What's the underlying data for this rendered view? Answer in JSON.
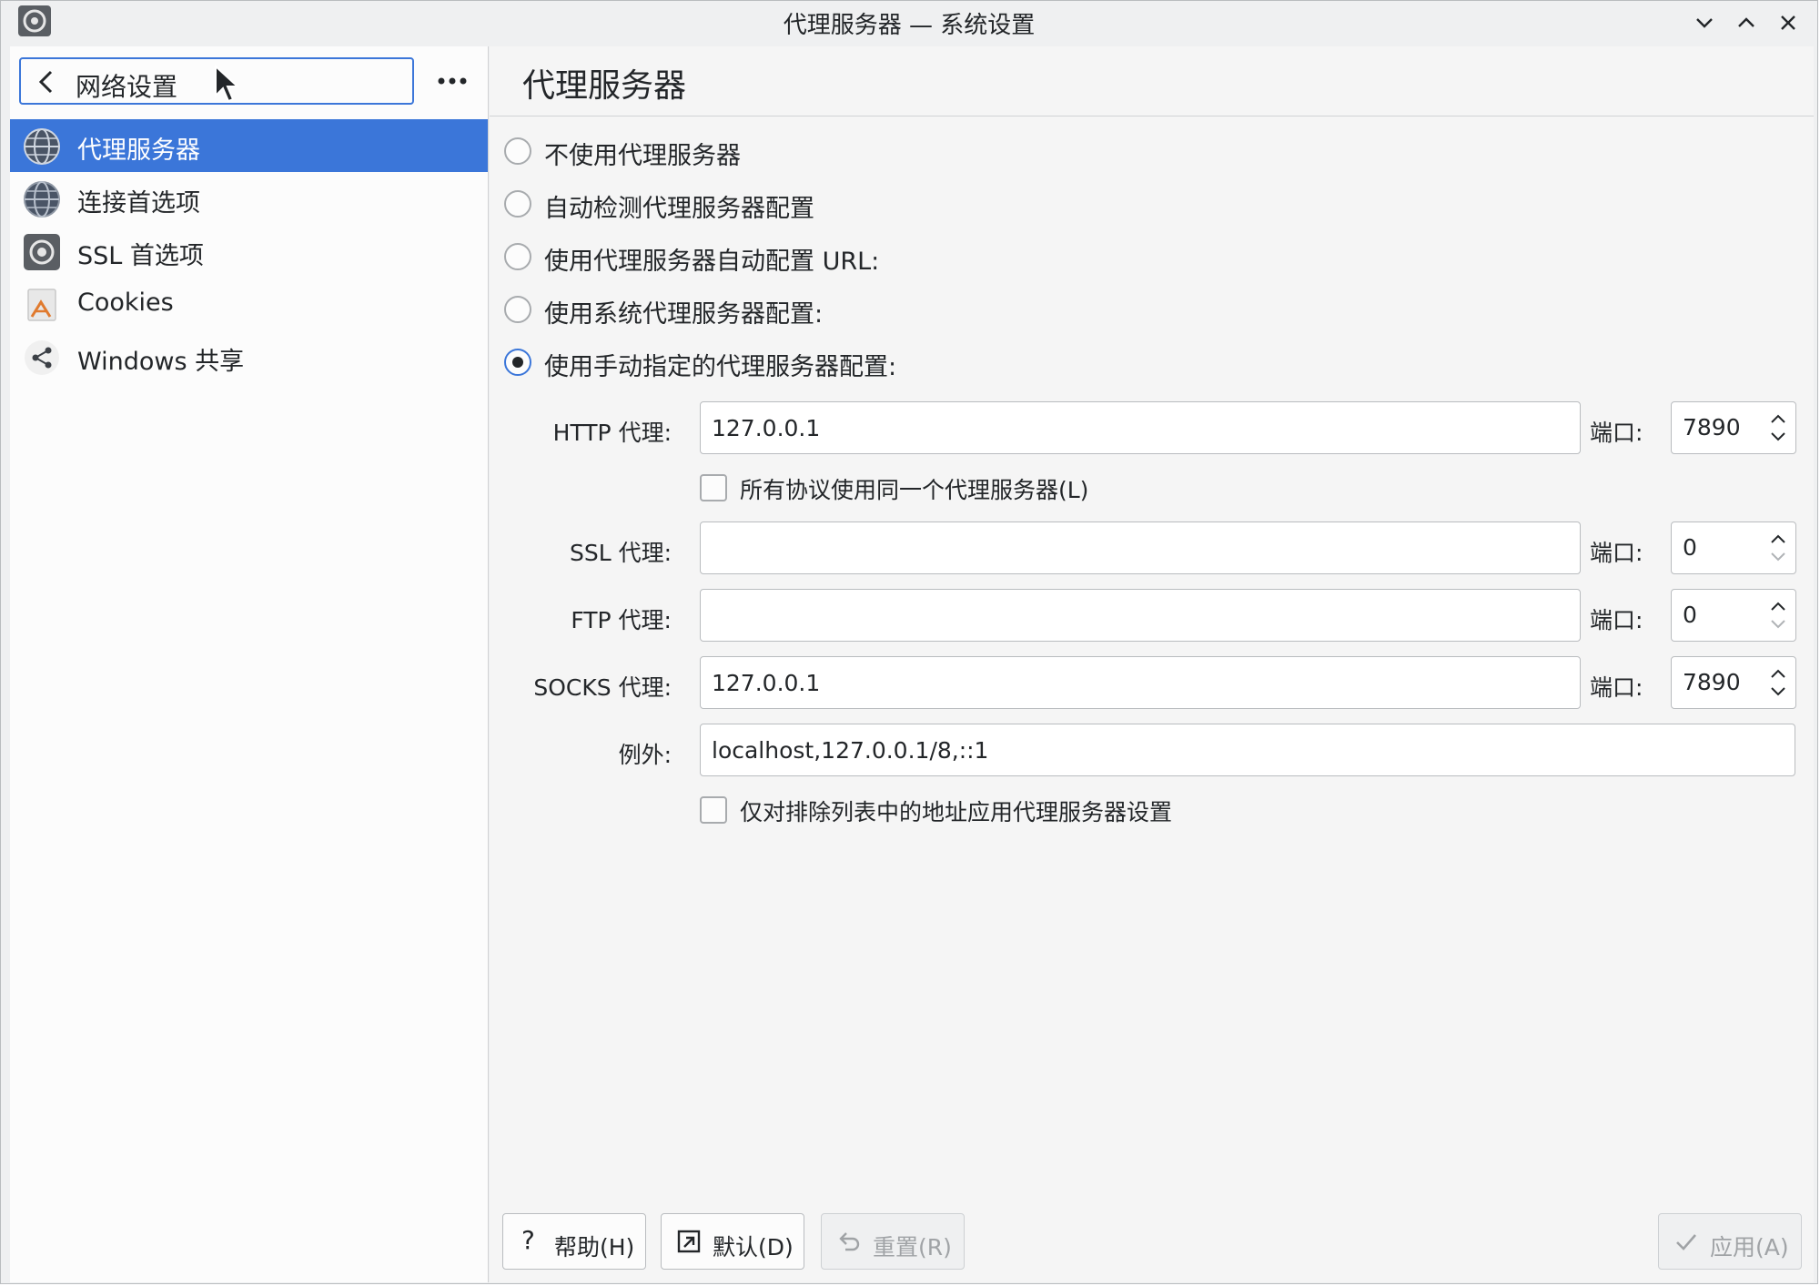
{
  "window": {
    "title": "代理服务器 — 系统设置"
  },
  "sidebar": {
    "back_label": "网络设置",
    "items": [
      {
        "label": "代理服务器",
        "icon": "globe-icon",
        "selected": true
      },
      {
        "label": "连接首选项",
        "icon": "globe-icon",
        "selected": false
      },
      {
        "label": "SSL 首选项",
        "icon": "gear-icon",
        "selected": false
      },
      {
        "label": "Cookies",
        "icon": "cookie-icon",
        "selected": false
      },
      {
        "label": "Windows 共享",
        "icon": "share-icon",
        "selected": false
      }
    ]
  },
  "main": {
    "title": "代理服务器",
    "options": [
      {
        "label": "不使用代理服务器",
        "checked": false
      },
      {
        "label": "自动检测代理服务器配置",
        "checked": false
      },
      {
        "label": "使用代理服务器自动配置 URL:",
        "checked": false
      },
      {
        "label": "使用系统代理服务器配置:",
        "checked": false
      },
      {
        "label": "使用手动指定的代理服务器配置:",
        "checked": true
      }
    ],
    "port_label": "端口:",
    "http": {
      "label": "HTTP 代理:",
      "value": "127.0.0.1",
      "port": "7890"
    },
    "same_proxy_label": "所有协议使用同一个代理服务器(L)",
    "ssl": {
      "label": "SSL 代理:",
      "value": "",
      "port": "0"
    },
    "ftp": {
      "label": "FTP 代理:",
      "value": "",
      "port": "0"
    },
    "socks": {
      "label": "SOCKS 代理:",
      "value": "127.0.0.1",
      "port": "7890"
    },
    "exceptions": {
      "label": "例外:",
      "value": "localhost,127.0.0.1/8,::1"
    },
    "only_exceptions_label": "仅对排除列表中的地址应用代理服务器设置"
  },
  "buttons": {
    "help": "帮助(H)",
    "defaults": "默认(D)",
    "reset": "重置(R)",
    "apply": "应用(A)"
  },
  "colors": {
    "accent": "#3b76d9",
    "window_bg": "#eff0f1",
    "content_bg": "#f5f5f5"
  }
}
